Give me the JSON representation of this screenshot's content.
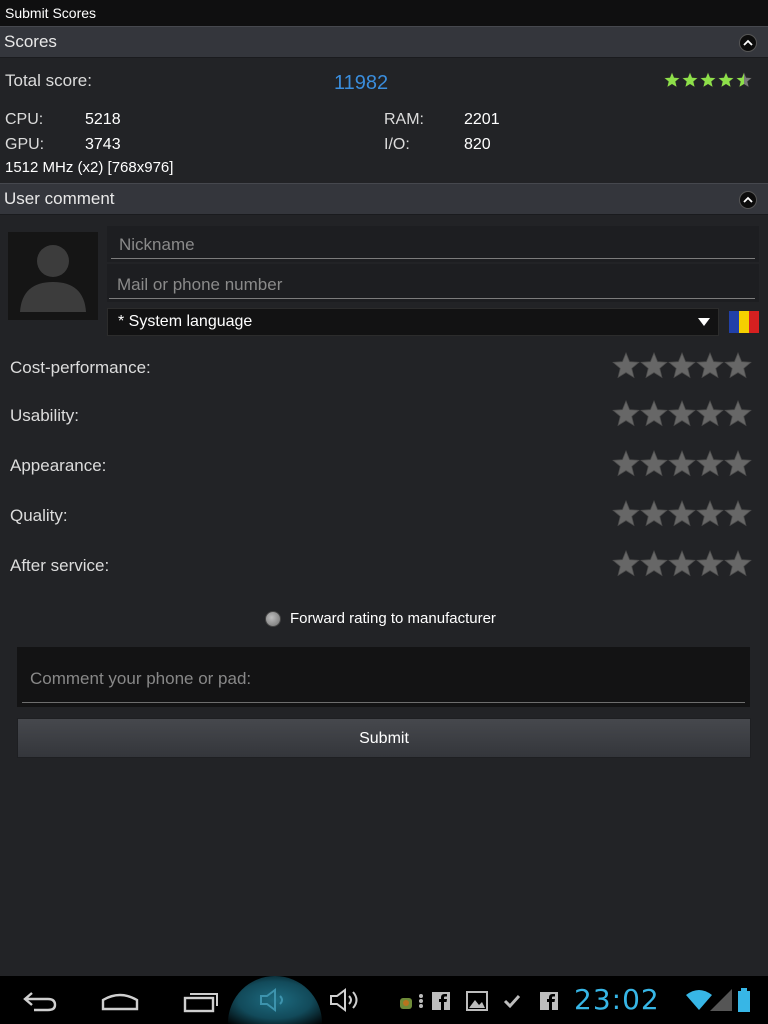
{
  "title": "Submit Scores",
  "scores_section": {
    "header": "Scores",
    "total_label": "Total score:",
    "total_value": "11982",
    "total_stars": 4.5,
    "cpu_label": "CPU:",
    "cpu_value": "5218",
    "gpu_label": "GPU:",
    "gpu_value": "3743",
    "ram_label": "RAM:",
    "ram_value": "2201",
    "io_label": "I/O:",
    "io_value": "820",
    "device_info": "1512 MHz (x2) [768x976]"
  },
  "comment_section": {
    "header": "User comment",
    "nickname_placeholder": "Nickname",
    "contact_placeholder": "Mail or phone number",
    "language_selected": "* System language",
    "flag_colors": [
      "#2140a8",
      "#f5d000",
      "#d62020"
    ],
    "ratings": [
      {
        "label": "Cost-performance:",
        "stars": 0
      },
      {
        "label": "Usability:",
        "stars": 0
      },
      {
        "label": "Appearance:",
        "stars": 0
      },
      {
        "label": "Quality:",
        "stars": 0
      },
      {
        "label": "After service:",
        "stars": 0
      }
    ],
    "forward_label": "Forward rating to manufacturer",
    "comment_placeholder": "Comment your phone or pad:",
    "submit_label": "Submit"
  },
  "navbar": {
    "clock": "23:02",
    "icons": [
      "back-icon",
      "home-icon",
      "recent-apps-icon",
      "volume-down-icon",
      "volume-up-icon",
      "android-debug-icon",
      "overflow-dots-icon",
      "facebook-icon",
      "gallery-icon",
      "check-icon",
      "facebook-icon",
      "wifi-icon",
      "signal-icon",
      "battery-icon"
    ]
  },
  "colors": {
    "accent": "#3a8ddc",
    "clock": "#37b6e6",
    "star_active": "#8ee04a",
    "star_empty": "#6a6a6a"
  }
}
